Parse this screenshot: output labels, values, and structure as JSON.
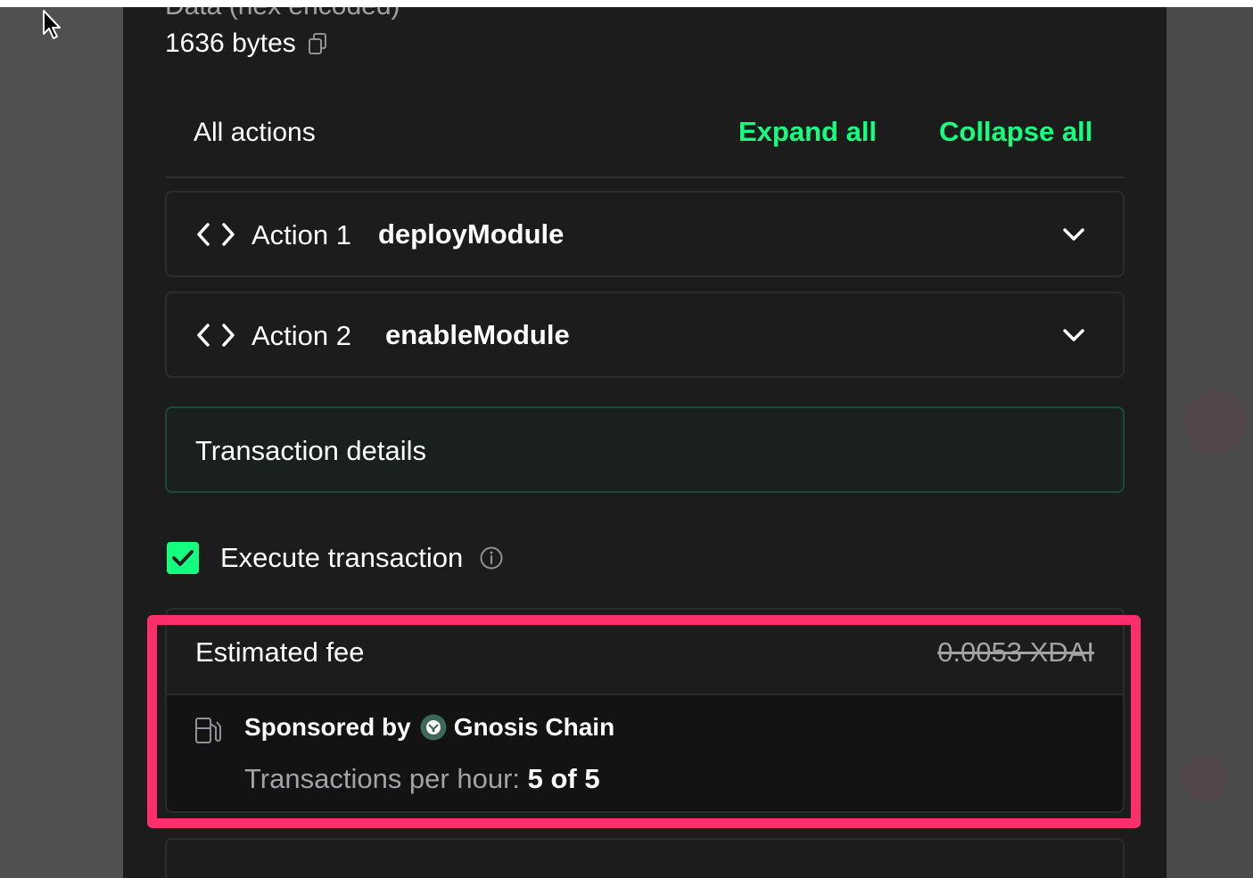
{
  "data_field": {
    "label": "Data (hex encoded)",
    "size": "1636 bytes"
  },
  "actions": {
    "heading": "All actions",
    "expand_all": "Expand all",
    "collapse_all": "Collapse all",
    "items": [
      {
        "label": "Action 1",
        "method": "deployModule"
      },
      {
        "label": "Action 2",
        "method": "enableModule"
      }
    ]
  },
  "transaction_details": {
    "label": "Transaction details"
  },
  "execute": {
    "label": "Execute transaction",
    "checked": true
  },
  "fee": {
    "label": "Estimated fee",
    "amount": "0.0053 XDAI",
    "sponsored_prefix": "Sponsored by",
    "sponsor": "Gnosis Chain",
    "tph_label": "Transactions per hour:",
    "tph_value": "5 of 5"
  },
  "colors": {
    "accent": "#12ff80",
    "highlight": "#ff2f6c",
    "panel": "#1c1c1c",
    "gnosis": "#3e6957"
  },
  "icons": [
    "cursor-icon",
    "copy-icon",
    "code-icon",
    "chevron-down-icon",
    "check-icon",
    "info-icon",
    "gas-pump-icon",
    "gnosis-chain-logo"
  ]
}
